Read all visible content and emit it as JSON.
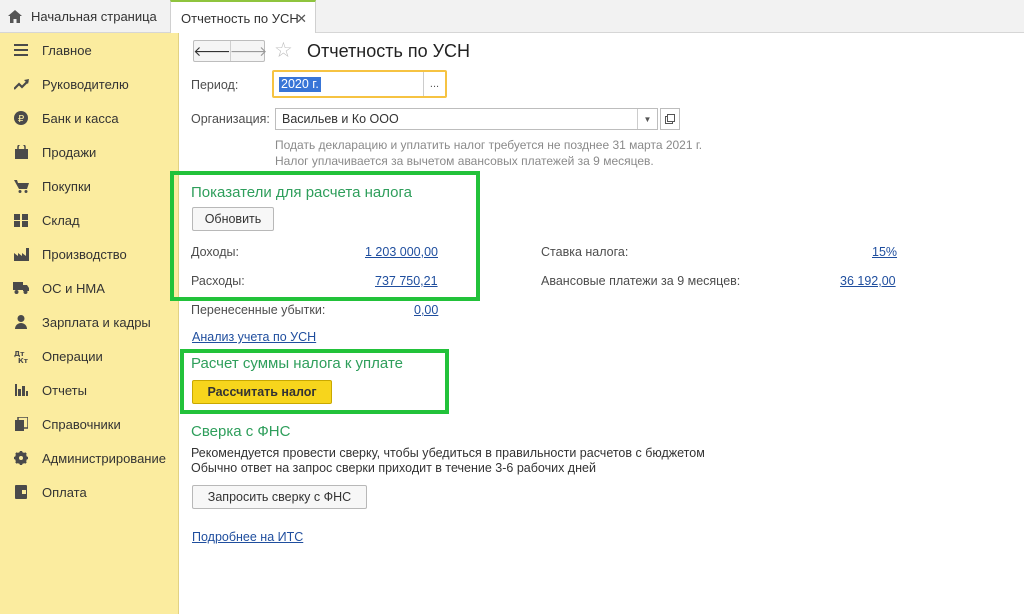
{
  "tabs": {
    "home_label": "Начальная страница",
    "active_label": "Отчетность по УСН",
    "close_glyph": "✕"
  },
  "sidebar": {
    "items": [
      {
        "label": "Главное",
        "icon": "menu-icon"
      },
      {
        "label": "Руководителю",
        "icon": "trend-icon"
      },
      {
        "label": "Банк и касса",
        "icon": "ruble-icon"
      },
      {
        "label": "Продажи",
        "icon": "bag-icon"
      },
      {
        "label": "Покупки",
        "icon": "cart-icon"
      },
      {
        "label": "Склад",
        "icon": "warehouse-icon"
      },
      {
        "label": "Производство",
        "icon": "factory-icon"
      },
      {
        "label": "ОС и НМА",
        "icon": "truck-icon"
      },
      {
        "label": "Зарплата и кадры",
        "icon": "person-icon"
      },
      {
        "label": "Операции",
        "icon": "dt-kt-icon"
      },
      {
        "label": "Отчеты",
        "icon": "bar-chart-icon"
      },
      {
        "label": "Справочники",
        "icon": "books-icon"
      },
      {
        "label": "Администрирование",
        "icon": "gear-icon"
      },
      {
        "label": "Оплата",
        "icon": "wallet-icon"
      }
    ]
  },
  "header": {
    "back_glyph": "🡐",
    "forward_glyph": "🡒",
    "star_glyph": "☆",
    "title": "Отчетность по УСН"
  },
  "form": {
    "period_label": "Период:",
    "period_value": "2020 г.",
    "period_button": "...",
    "org_label": "Организация:",
    "org_value": "Васильев и Ко ООО",
    "hint_line1": "Подать декларацию и уплатить налог требуется не позднее 31 марта 2021 г.",
    "hint_line2": "Налог уплачивается за вычетом авансовых платежей за 9 месяцев."
  },
  "indicators": {
    "title": "Показатели для расчета налога",
    "refresh_button": "Обновить",
    "income_label": "Доходы:",
    "income_value": "1 203 000,00",
    "expenses_label": "Расходы:",
    "expenses_value": "737 750,21",
    "losses_label": "Перенесенные убытки:",
    "losses_value": "0,00",
    "rate_label": "Ставка налога:",
    "rate_value": "15%",
    "advance_label": "Авансовые платежи за 9 месяцев:",
    "advance_value": "36 192,00",
    "analysis_link": "Анализ учета по УСН"
  },
  "calculation": {
    "title": "Расчет суммы налога к уплате",
    "calc_button": "Рассчитать налог"
  },
  "fns": {
    "title": "Сверка с ФНС",
    "text_line1": "Рекомендуется провести сверку, чтобы убедиться в правильности расчетов с бюджетом",
    "text_line2": "Обычно ответ на запрос сверки приходит в течение 3-6 рабочих дней",
    "request_button": "Запросить сверку с ФНС",
    "more_link": "Подробнее на ИТС"
  },
  "colors": {
    "sidebar_bg": "#fbec9f",
    "section_title": "#2e9e5b",
    "link": "#1f4e9e",
    "highlight": "#22c23a",
    "primary_button": "#f7d51c"
  }
}
